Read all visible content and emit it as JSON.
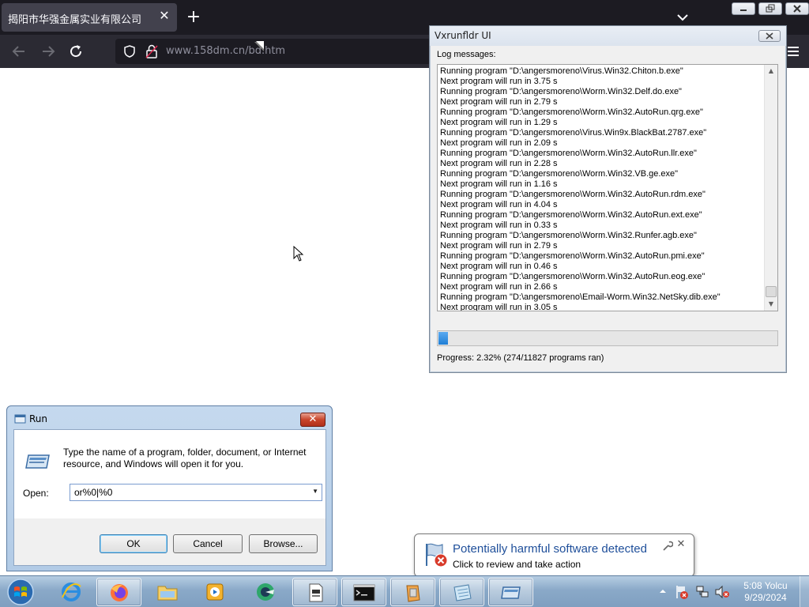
{
  "browser": {
    "tab_title": "揭阳市华强金属实业有限公司",
    "tab_close_icon": "close-icon",
    "new_tab_icon": "plus-icon",
    "url": "www.158dm.cn/bd.htm"
  },
  "vxrunfldr": {
    "title": "Vxrunfldr UI",
    "log_label": "Log messages:",
    "log_lines": [
      "Running program \"D:\\angersmoreno\\Virus.Win32.Chiton.b.exe\"",
      "Next program will run in 3.75 s",
      "Running program \"D:\\angersmoreno\\Worm.Win32.Delf.do.exe\"",
      "Next program will run in 2.79 s",
      "Running program \"D:\\angersmoreno\\Worm.Win32.AutoRun.qrg.exe\"",
      "Next program will run in 1.29 s",
      "Running program \"D:\\angersmoreno\\Virus.Win9x.BlackBat.2787.exe\"",
      "Next program will run in 2.09 s",
      "Running program \"D:\\angersmoreno\\Worm.Win32.AutoRun.llr.exe\"",
      "Next program will run in 2.28 s",
      "Running program \"D:\\angersmoreno\\Worm.Win32.VB.ge.exe\"",
      "Next program will run in 1.16 s",
      "Running program \"D:\\angersmoreno\\Worm.Win32.AutoRun.rdm.exe\"",
      "Next program will run in 4.04 s",
      "Running program \"D:\\angersmoreno\\Worm.Win32.AutoRun.ext.exe\"",
      "Next program will run in 0.33 s",
      "Running program \"D:\\angersmoreno\\Worm.Win32.Runfer.agb.exe\"",
      "Next program will run in 2.79 s",
      "Running program \"D:\\angersmoreno\\Worm.Win32.AutoRun.pmi.exe\"",
      "Next program will run in 0.46 s",
      "Running program \"D:\\angersmoreno\\Worm.Win32.AutoRun.eog.exe\"",
      "Next program will run in 2.66 s",
      "Running program \"D:\\angersmoreno\\Email-Worm.Win32.NetSky.dib.exe\"",
      "Next program will run in 3.05 s"
    ],
    "progress_fraction": 0.0232,
    "progress_text": "Progress: 2.32% (274/11827 programs ran)"
  },
  "run_dialog": {
    "title": "Run",
    "description": "Type the name of a program, folder, document, or Internet resource, and Windows will open it for you.",
    "open_label": "Open:",
    "open_value": "or%0|%0",
    "ok_label": "OK",
    "cancel_label": "Cancel",
    "browse_label": "Browse..."
  },
  "notification": {
    "title": "Potentially harmful software detected",
    "message": "Click to review and take action"
  },
  "taskbar": {
    "items": [
      "start-orb",
      "internet-explorer",
      "firefox",
      "windows-explorer",
      "media-player",
      "app-green-circle",
      "document-viewer",
      "command-prompt",
      "archive-app",
      "notepad-app",
      "vxrunfldr-app"
    ],
    "clock_time": "5:08 Yolcu",
    "clock_date": "9/29/2024"
  },
  "colors": {
    "browser_dark": "#1c1b22",
    "progress_blue": "#1f7fd6",
    "notification_title": "#1f4f9a"
  }
}
